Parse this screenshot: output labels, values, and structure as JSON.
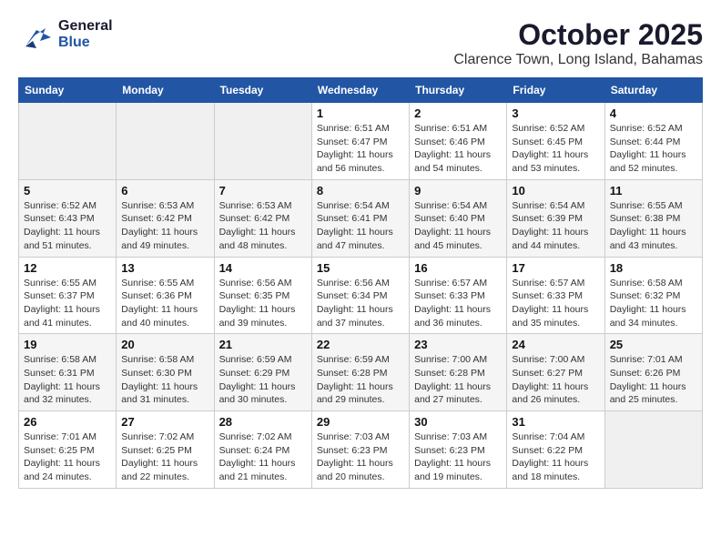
{
  "header": {
    "logo_general": "General",
    "logo_blue": "Blue",
    "month_title": "October 2025",
    "subtitle": "Clarence Town, Long Island, Bahamas"
  },
  "days_of_week": [
    "Sunday",
    "Monday",
    "Tuesday",
    "Wednesday",
    "Thursday",
    "Friday",
    "Saturday"
  ],
  "weeks": [
    [
      {
        "day": "",
        "info": ""
      },
      {
        "day": "",
        "info": ""
      },
      {
        "day": "",
        "info": ""
      },
      {
        "day": "1",
        "info": "Sunrise: 6:51 AM\nSunset: 6:47 PM\nDaylight: 11 hours and 56 minutes."
      },
      {
        "day": "2",
        "info": "Sunrise: 6:51 AM\nSunset: 6:46 PM\nDaylight: 11 hours and 54 minutes."
      },
      {
        "day": "3",
        "info": "Sunrise: 6:52 AM\nSunset: 6:45 PM\nDaylight: 11 hours and 53 minutes."
      },
      {
        "day": "4",
        "info": "Sunrise: 6:52 AM\nSunset: 6:44 PM\nDaylight: 11 hours and 52 minutes."
      }
    ],
    [
      {
        "day": "5",
        "info": "Sunrise: 6:52 AM\nSunset: 6:43 PM\nDaylight: 11 hours and 51 minutes."
      },
      {
        "day": "6",
        "info": "Sunrise: 6:53 AM\nSunset: 6:42 PM\nDaylight: 11 hours and 49 minutes."
      },
      {
        "day": "7",
        "info": "Sunrise: 6:53 AM\nSunset: 6:42 PM\nDaylight: 11 hours and 48 minutes."
      },
      {
        "day": "8",
        "info": "Sunrise: 6:54 AM\nSunset: 6:41 PM\nDaylight: 11 hours and 47 minutes."
      },
      {
        "day": "9",
        "info": "Sunrise: 6:54 AM\nSunset: 6:40 PM\nDaylight: 11 hours and 45 minutes."
      },
      {
        "day": "10",
        "info": "Sunrise: 6:54 AM\nSunset: 6:39 PM\nDaylight: 11 hours and 44 minutes."
      },
      {
        "day": "11",
        "info": "Sunrise: 6:55 AM\nSunset: 6:38 PM\nDaylight: 11 hours and 43 minutes."
      }
    ],
    [
      {
        "day": "12",
        "info": "Sunrise: 6:55 AM\nSunset: 6:37 PM\nDaylight: 11 hours and 41 minutes."
      },
      {
        "day": "13",
        "info": "Sunrise: 6:55 AM\nSunset: 6:36 PM\nDaylight: 11 hours and 40 minutes."
      },
      {
        "day": "14",
        "info": "Sunrise: 6:56 AM\nSunset: 6:35 PM\nDaylight: 11 hours and 39 minutes."
      },
      {
        "day": "15",
        "info": "Sunrise: 6:56 AM\nSunset: 6:34 PM\nDaylight: 11 hours and 37 minutes."
      },
      {
        "day": "16",
        "info": "Sunrise: 6:57 AM\nSunset: 6:33 PM\nDaylight: 11 hours and 36 minutes."
      },
      {
        "day": "17",
        "info": "Sunrise: 6:57 AM\nSunset: 6:33 PM\nDaylight: 11 hours and 35 minutes."
      },
      {
        "day": "18",
        "info": "Sunrise: 6:58 AM\nSunset: 6:32 PM\nDaylight: 11 hours and 34 minutes."
      }
    ],
    [
      {
        "day": "19",
        "info": "Sunrise: 6:58 AM\nSunset: 6:31 PM\nDaylight: 11 hours and 32 minutes."
      },
      {
        "day": "20",
        "info": "Sunrise: 6:58 AM\nSunset: 6:30 PM\nDaylight: 11 hours and 31 minutes."
      },
      {
        "day": "21",
        "info": "Sunrise: 6:59 AM\nSunset: 6:29 PM\nDaylight: 11 hours and 30 minutes."
      },
      {
        "day": "22",
        "info": "Sunrise: 6:59 AM\nSunset: 6:28 PM\nDaylight: 11 hours and 29 minutes."
      },
      {
        "day": "23",
        "info": "Sunrise: 7:00 AM\nSunset: 6:28 PM\nDaylight: 11 hours and 27 minutes."
      },
      {
        "day": "24",
        "info": "Sunrise: 7:00 AM\nSunset: 6:27 PM\nDaylight: 11 hours and 26 minutes."
      },
      {
        "day": "25",
        "info": "Sunrise: 7:01 AM\nSunset: 6:26 PM\nDaylight: 11 hours and 25 minutes."
      }
    ],
    [
      {
        "day": "26",
        "info": "Sunrise: 7:01 AM\nSunset: 6:25 PM\nDaylight: 11 hours and 24 minutes."
      },
      {
        "day": "27",
        "info": "Sunrise: 7:02 AM\nSunset: 6:25 PM\nDaylight: 11 hours and 22 minutes."
      },
      {
        "day": "28",
        "info": "Sunrise: 7:02 AM\nSunset: 6:24 PM\nDaylight: 11 hours and 21 minutes."
      },
      {
        "day": "29",
        "info": "Sunrise: 7:03 AM\nSunset: 6:23 PM\nDaylight: 11 hours and 20 minutes."
      },
      {
        "day": "30",
        "info": "Sunrise: 7:03 AM\nSunset: 6:23 PM\nDaylight: 11 hours and 19 minutes."
      },
      {
        "day": "31",
        "info": "Sunrise: 7:04 AM\nSunset: 6:22 PM\nDaylight: 11 hours and 18 minutes."
      },
      {
        "day": "",
        "info": ""
      }
    ]
  ]
}
